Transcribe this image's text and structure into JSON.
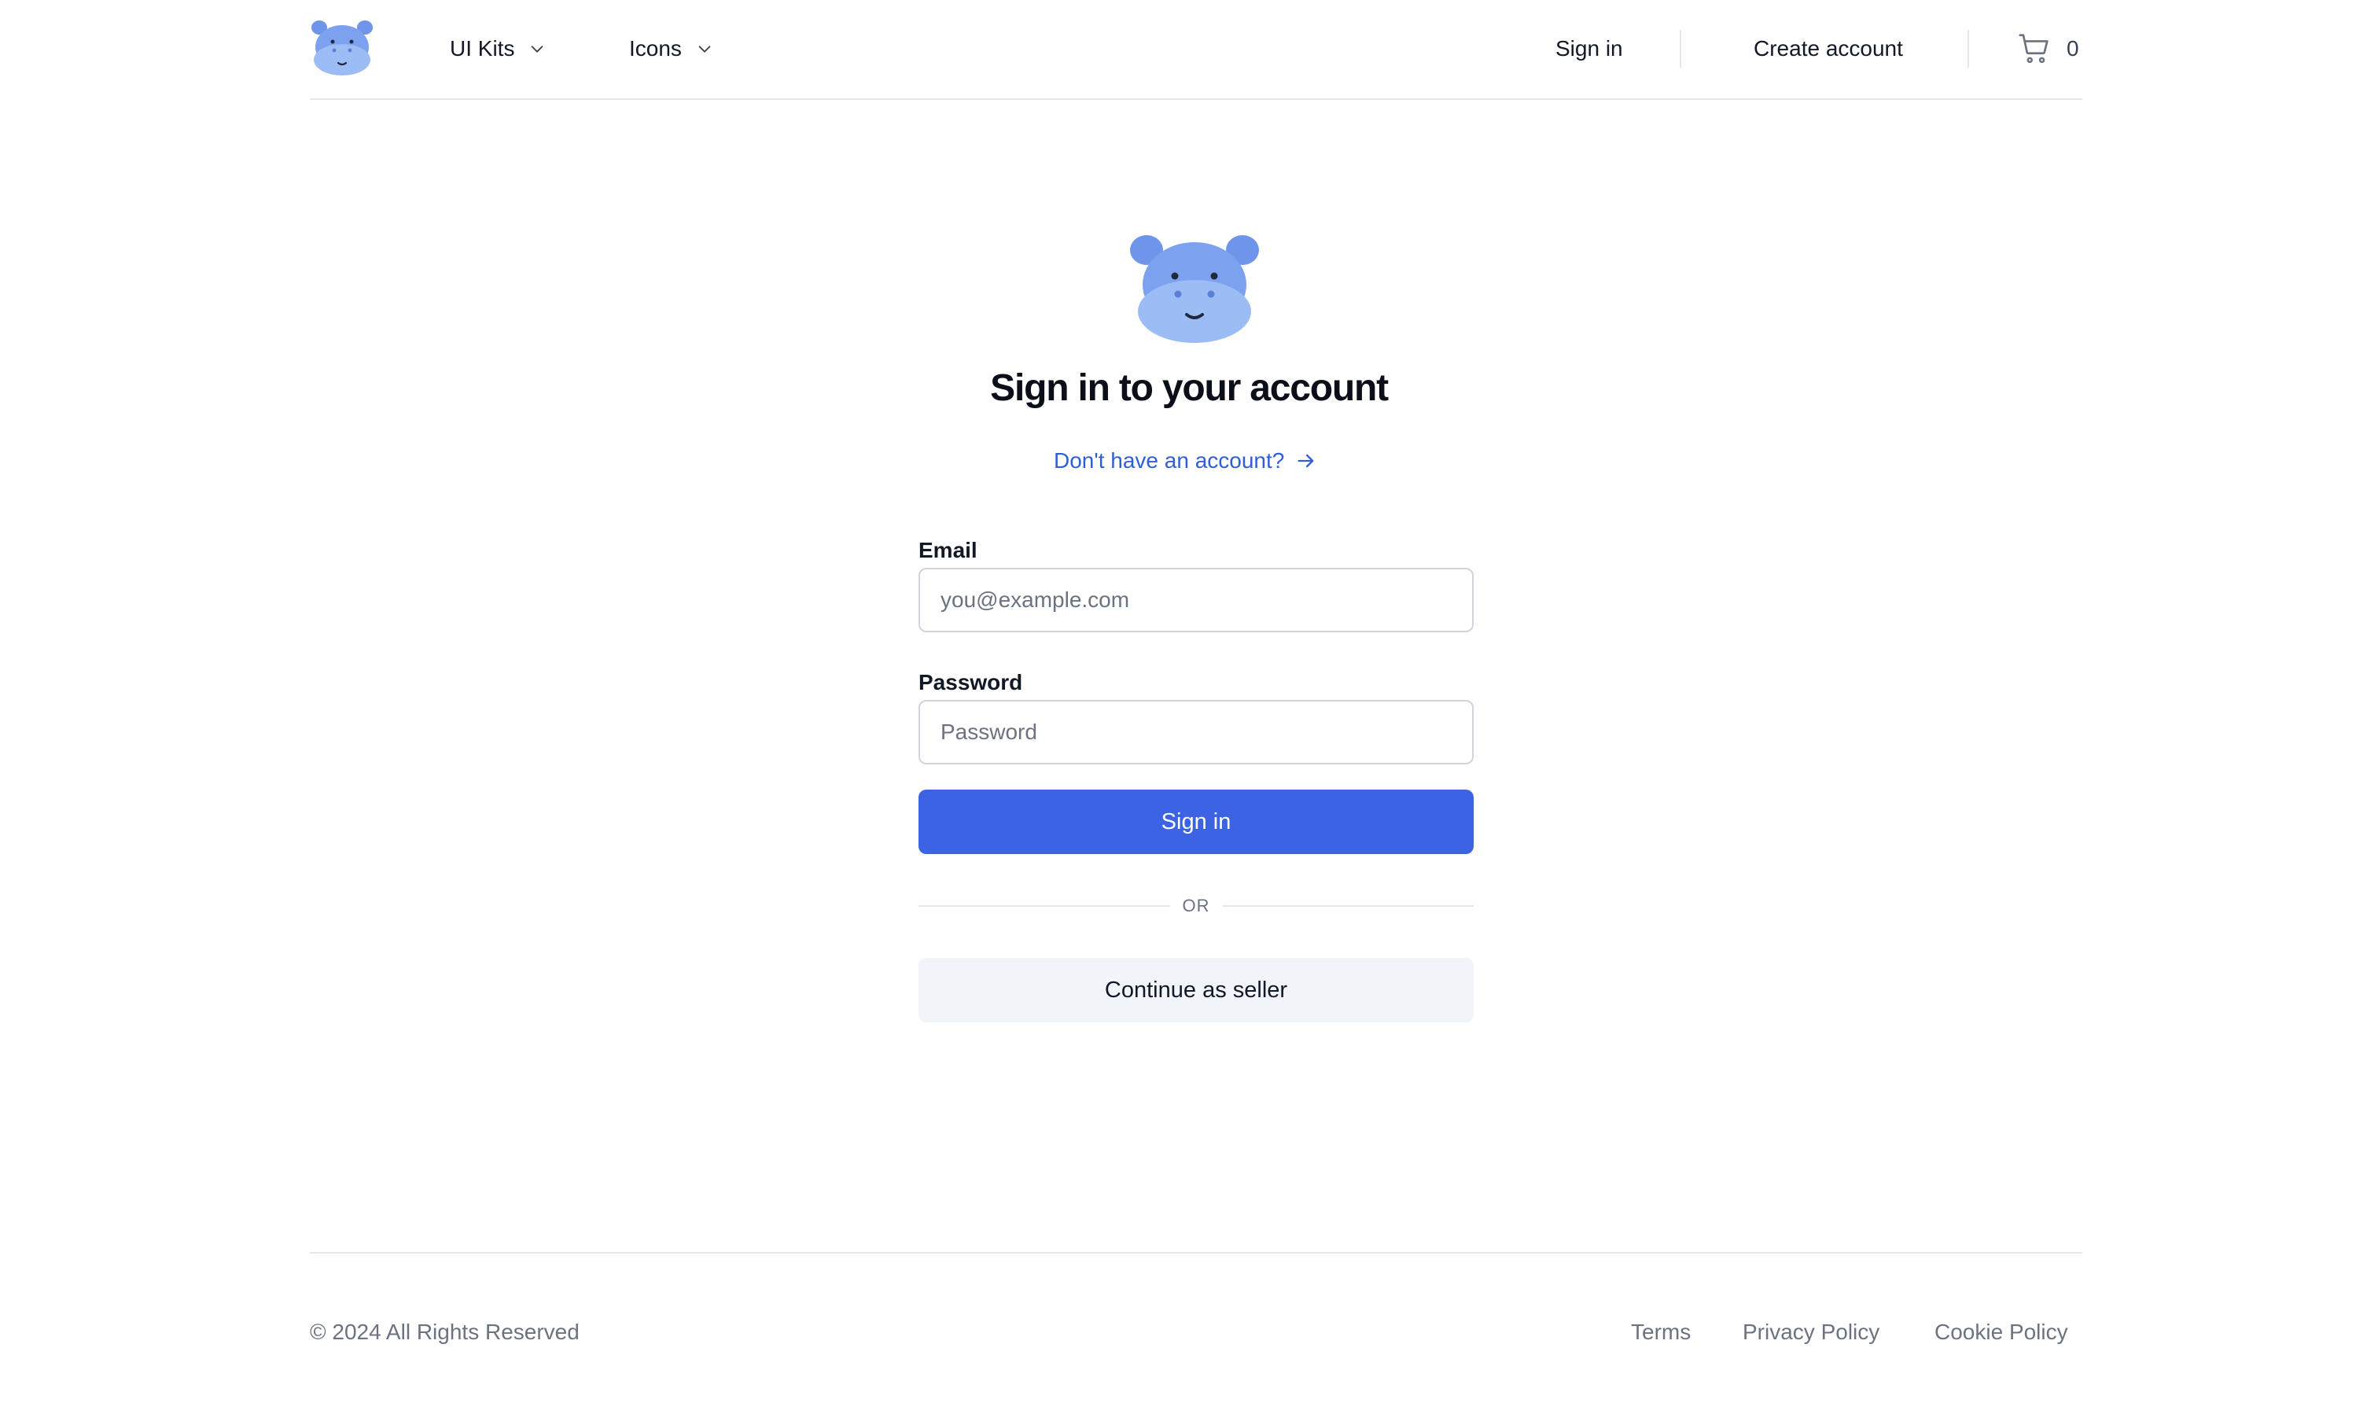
{
  "header": {
    "logo_icon": "hippo-logo-icon",
    "nav": [
      {
        "label": "UI Kits",
        "icon": "chevron-down-icon"
      },
      {
        "label": "Icons",
        "icon": "chevron-down-icon"
      }
    ],
    "sign_in": "Sign in",
    "create_account": "Create account",
    "cart_icon": "shopping-cart-icon",
    "cart_count": "0"
  },
  "main": {
    "logo_icon": "hippo-logo-icon",
    "title": "Sign in to your account",
    "alt_link": "Don't have an account?",
    "alt_link_icon": "arrow-right-icon",
    "email": {
      "label": "Email",
      "placeholder": "you@example.com",
      "value": ""
    },
    "password": {
      "label": "Password",
      "placeholder": "Password",
      "value": ""
    },
    "submit_label": "Sign in",
    "divider_text": "OR",
    "seller_label": "Continue as seller"
  },
  "footer": {
    "copyright": "© 2024 All Rights Reserved",
    "links": [
      "Terms",
      "Privacy Policy",
      "Cookie Policy"
    ]
  },
  "colors": {
    "primary": "#3b63e3",
    "link": "#2f5fd7",
    "logo_body": "#7ba1ef",
    "logo_face": "#9cbcf6"
  }
}
